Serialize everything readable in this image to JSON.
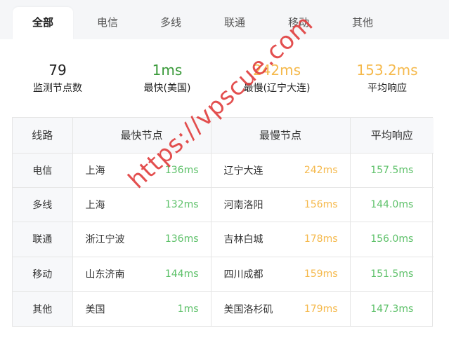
{
  "tabs": [
    {
      "label": "全部",
      "active": true
    },
    {
      "label": "电信",
      "active": false
    },
    {
      "label": "多线",
      "active": false
    },
    {
      "label": "联通",
      "active": false
    },
    {
      "label": "移动",
      "active": false
    },
    {
      "label": "其他",
      "active": false
    }
  ],
  "stats": [
    {
      "value": "79",
      "label": "监测节点数",
      "color": "#222222"
    },
    {
      "value": "1ms",
      "label": "最快(美国)",
      "color": "#3a9a3a"
    },
    {
      "value": "242ms",
      "label": "最慢(辽宁大连)",
      "color": "#f5b94c"
    },
    {
      "value": "153.2ms",
      "label": "平均响应",
      "color": "#f5b94c"
    }
  ],
  "table": {
    "headers": [
      "线路",
      "最快节点",
      "最慢节点",
      "平均响应"
    ],
    "rows": [
      {
        "line": "电信",
        "fast_name": "上海",
        "fast_ms": "136ms",
        "slow_name": "辽宁大连",
        "slow_ms": "242ms",
        "avg": "157.5ms"
      },
      {
        "line": "多线",
        "fast_name": "上海",
        "fast_ms": "132ms",
        "slow_name": "河南洛阳",
        "slow_ms": "156ms",
        "avg": "144.0ms"
      },
      {
        "line": "联通",
        "fast_name": "浙江宁波",
        "fast_ms": "136ms",
        "slow_name": "吉林白城",
        "slow_ms": "178ms",
        "avg": "156.0ms"
      },
      {
        "line": "移动",
        "fast_name": "山东济南",
        "fast_ms": "144ms",
        "slow_name": "四川成都",
        "slow_ms": "159ms",
        "avg": "151.5ms"
      },
      {
        "line": "其他",
        "fast_name": "美国",
        "fast_ms": "1ms",
        "slow_name": "美国洛杉矶",
        "slow_ms": "179ms",
        "avg": "147.3ms"
      }
    ]
  },
  "watermark": "https://vpscue.com",
  "colors": {
    "fast_ms": "#5ec16a",
    "slow_ms": "#f5b94c",
    "avg": "#5ec16a"
  }
}
